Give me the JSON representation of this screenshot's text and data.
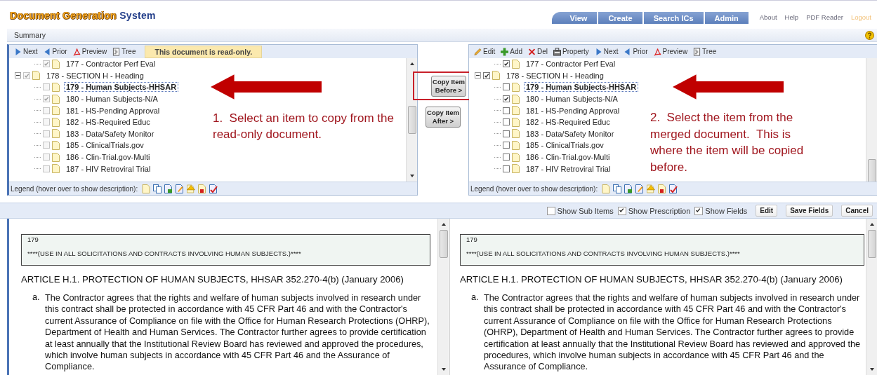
{
  "header": {
    "logo_main": "Document Generation",
    "logo_accent": "System",
    "nav_tabs": [
      {
        "label": "View"
      },
      {
        "label": "Create"
      },
      {
        "label": "Search ICs"
      },
      {
        "label": "Admin"
      }
    ],
    "links": [
      {
        "label": "About",
        "kind": "link"
      },
      {
        "label": "Help",
        "kind": "link"
      },
      {
        "label": "PDF Reader",
        "kind": "link"
      },
      {
        "label": "Logout",
        "kind": "logout"
      }
    ]
  },
  "summary_bar": {
    "title": "Summary"
  },
  "source_panel": {
    "toolbar": [
      {
        "label": "Next",
        "kind": "next"
      },
      {
        "label": "Prior",
        "kind": "prior"
      },
      {
        "label": "Preview",
        "kind": "preview"
      },
      {
        "label": "Tree",
        "kind": "tree"
      }
    ],
    "notice": "This document is read-only.",
    "checkboxes_disabled": true,
    "tree": [
      {
        "kind": "continued",
        "children": [
          {
            "label": "177 - Contractor Perf Eval",
            "checked": true,
            "selected": false
          }
        ]
      },
      {
        "kind": "section",
        "label": "178 - SECTION H - Heading",
        "checked": true,
        "selected": false,
        "expanded": true,
        "children": [
          {
            "label": "179 - Human Subjects-HHSAR",
            "checked": false,
            "selected": true
          },
          {
            "label": "180 - Human Subjects-N/A",
            "checked": true,
            "selected": false
          },
          {
            "label": "181 - HS-Pending Approval",
            "checked": false,
            "selected": false
          },
          {
            "label": "182 - HS-Required Educ",
            "checked": false,
            "selected": false
          },
          {
            "label": "183 - Data/Safety Monitor",
            "checked": false,
            "selected": false
          },
          {
            "label": "185 - ClinicalTrials.gov",
            "checked": false,
            "selected": false
          },
          {
            "label": "186 - Clin-Trial.gov-Multi",
            "checked": false,
            "selected": false
          },
          {
            "label": "187 - HIV Retroviral Trial",
            "checked": false,
            "selected": false
          }
        ]
      }
    ],
    "legend": "Legend (hover over to show description):",
    "annotation": "1.  Select an item to copy from the read-only document."
  },
  "copy_buttons": [
    {
      "lines": [
        "Copy Item",
        "Before >"
      ],
      "highlighted": true
    },
    {
      "lines": [
        "Copy Item",
        "After >"
      ],
      "highlighted": false
    }
  ],
  "target_panel": {
    "toolbar": [
      {
        "label": "Edit",
        "kind": "edit"
      },
      {
        "label": "Add",
        "kind": "add"
      },
      {
        "label": "Del",
        "kind": "del"
      },
      {
        "label": "Property",
        "kind": "property"
      },
      {
        "label": "Next",
        "kind": "next"
      },
      {
        "label": "Prior",
        "kind": "prior"
      },
      {
        "label": "Preview",
        "kind": "preview"
      },
      {
        "label": "Tree",
        "kind": "tree"
      }
    ],
    "checkboxes_disabled": false,
    "tree": [
      {
        "kind": "continued",
        "children": [
          {
            "label": "177 - Contractor Perf Eval",
            "checked": true,
            "selected": false
          }
        ]
      },
      {
        "kind": "section",
        "label": "178 - SECTION H - Heading",
        "checked": true,
        "selected": false,
        "expanded": true,
        "children": [
          {
            "label": "179 - Human Subjects-HHSAR",
            "checked": false,
            "selected": true
          },
          {
            "label": "180 - Human Subjects-N/A",
            "checked": true,
            "selected": false
          },
          {
            "label": "181 - HS-Pending Approval",
            "checked": false,
            "selected": false
          },
          {
            "label": "182 - HS-Required Educ",
            "checked": false,
            "selected": false
          },
          {
            "label": "183 - Data/Safety Monitor",
            "checked": false,
            "selected": false
          },
          {
            "label": "185 - ClinicalTrials.gov",
            "checked": false,
            "selected": false
          },
          {
            "label": "186 - Clin-Trial.gov-Multi",
            "checked": false,
            "selected": false
          },
          {
            "label": "187 - HIV Retroviral Trial",
            "checked": false,
            "selected": false
          }
        ]
      }
    ],
    "legend": "Legend (hover over to show description):",
    "annotation": "2.  Select the item from the merged document.  This is where the item will be copied before."
  },
  "options_bar": {
    "checkboxes": [
      {
        "label": "Show Sub Items",
        "checked": false
      },
      {
        "label": "Show Prescription",
        "checked": true
      },
      {
        "label": "Show Fields",
        "checked": true
      }
    ],
    "buttons": [
      "Edit",
      "Save Fields",
      "Cancel"
    ]
  },
  "documents": [
    {
      "number": "179",
      "instruction": "****(USE IN ALL SOLICITATIONS AND CONTRACTS INVOLVING HUMAN SUBJECTS.)****",
      "heading": "ARTICLE H.1. PROTECTION OF HUMAN SUBJECTS, HHSAR 352.270-4(b) (January 2006)",
      "items": [
        {
          "marker": "a.",
          "text": "The Contractor agrees that the rights and welfare of human subjects involved in research under this contract shall be protected in accordance with 45 CFR Part 46 and with the Contractor's current Assurance of Compliance on file with the Office for Human Research Protections (OHRP), Department of Health and Human Services. The Contractor further agrees to provide certification at least annually that the Institutional Review Board has reviewed and approved the procedures, which involve human subjects in accordance with 45 CFR Part 46 and the Assurance of Compliance."
        }
      ]
    },
    {
      "number": "179",
      "instruction": "****(USE IN ALL SOLICITATIONS AND CONTRACTS INVOLVING HUMAN SUBJECTS.)****",
      "heading": "ARTICLE H.1. PROTECTION OF HUMAN SUBJECTS, HHSAR 352.270-4(b) (January 2006)",
      "items": [
        {
          "marker": "a.",
          "text": "The Contractor agrees that the rights and welfare of human subjects involved in research under this contract shall be protected in accordance with 45 CFR Part 46 and with the Contractor's current Assurance of Compliance on file with the Office for Human Research Protections (OHRP), Department of Health and Human Services. The Contractor further agrees to provide certification at least annually that the Institutional Review Board has reviewed and approved the procedures, which involve human subjects in accordance with 45 CFR Part 46 and the Assurance of Compliance."
        }
      ]
    }
  ]
}
